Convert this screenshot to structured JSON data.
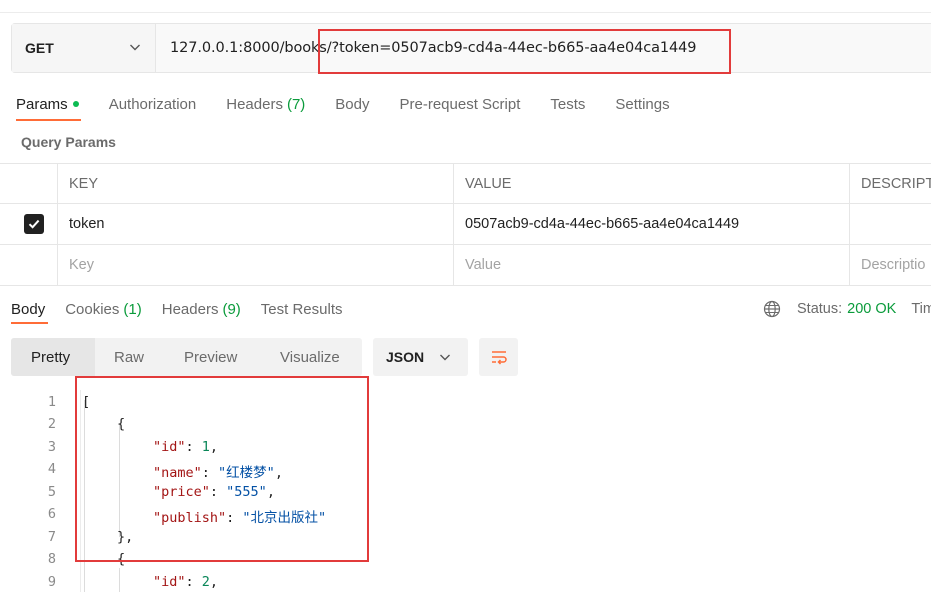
{
  "request": {
    "method": "GET",
    "url_base": "127.0.0.1:8000/books/",
    "url_query": "?token=0507acb9-cd4a-44ec-b665-aa4e04ca1449"
  },
  "request_tabs": {
    "params": "Params",
    "authorization": "Authorization",
    "headers": "Headers",
    "headers_count": "(7)",
    "body": "Body",
    "prerequest": "Pre-request Script",
    "tests": "Tests",
    "settings": "Settings"
  },
  "query_params": {
    "title": "Query Params",
    "columns": {
      "key": "KEY",
      "value": "VALUE",
      "description": "DESCRIPT"
    },
    "row": {
      "key": "token",
      "value": "0507acb9-cd4a-44ec-b665-aa4e04ca1449",
      "checked": true
    },
    "new_row": {
      "key_placeholder": "Key",
      "value_placeholder": "Value",
      "description_placeholder": "Descriptio"
    }
  },
  "response_tabs": {
    "body": "Body",
    "cookies": "Cookies",
    "cookies_count": "(1)",
    "headers": "Headers",
    "headers_count": "(9)",
    "test_results": "Test Results"
  },
  "status": {
    "label": "Status:",
    "value": "200 OK",
    "time_label": "Tim"
  },
  "view": {
    "options": [
      "Pretty",
      "Raw",
      "Preview",
      "Visualize"
    ],
    "format": "JSON"
  },
  "code": {
    "line_numbers": [
      "1",
      "2",
      "3",
      "4",
      "5",
      "6",
      "7",
      "8",
      "9"
    ],
    "l1": "[",
    "l2": "{",
    "l3_key": "\"id\"",
    "l3_val": "1",
    "l4_key": "\"name\"",
    "l4_val": "\"红楼梦\"",
    "l5_key": "\"price\"",
    "l5_val": "\"555\"",
    "l6_key": "\"publish\"",
    "l6_val": "\"北京出版社\"",
    "l7": "},",
    "l8": "{",
    "l9_key": "\"id\"",
    "l9_val": "2"
  },
  "colors": {
    "accent": "#ff6c37",
    "status_green": "#0a9b3b",
    "highlight_red": "#e23b3b"
  }
}
